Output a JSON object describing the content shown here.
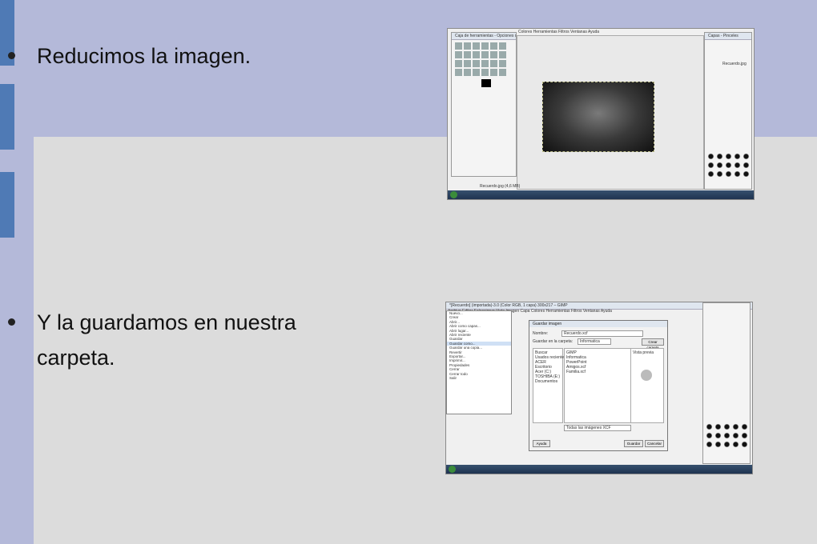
{
  "slide": {
    "bullets": [
      "Reducimos la imagen.",
      "Y la guardamos en nuestra carpeta."
    ]
  },
  "shot1": {
    "title": "Caja de herramientas - Opciones de herram...",
    "menu": "Colores  Herramientas  Filtros  Ventanas  Ayuda",
    "right_title": "Capas - Pinceles",
    "layer_name": "Recuerdo.jpg",
    "status": "Recuerdo.jpg (4,6 MB)"
  },
  "shot2": {
    "title": "*[Recuerdo] (importada)-3.0 (Color RGB, 1 capa) 300x217 – GIMP",
    "menubar": "Archivo  Editar  Seleccionar  Vista  Imagen  Capa  Colores  Herramientas  Filtros  Ventanas  Ayuda",
    "menu_items": [
      "Nuevo...",
      "Crear",
      "Abrir...",
      "Abrir como capas...",
      "Abrir lugar...",
      "Abrir reciente",
      "Guardar",
      "Guardar como...",
      "Guardar una copia...",
      "Revertir",
      "Exportar...",
      "Imprimir...",
      "Propiedades",
      "Cerrar",
      "Cerrar todo",
      "Salir"
    ],
    "dialog_title": "Guardar imagen",
    "name_label": "Nombre:",
    "name_value": "Recuerdo.xcf",
    "folder_label": "Guardar en la carpeta:",
    "folder_value": "Informatica",
    "create_folder": "Crear carpeta",
    "places": [
      "Buscar",
      "Usados recientemente",
      "ACER",
      "Escritorio",
      "Acer (C:)",
      "TOSHIBA (E:)",
      "Documentos"
    ],
    "files": [
      "GIMP",
      "Informatica",
      "PowerPoint",
      "Amigos.xcf",
      "Familia.xcf"
    ],
    "preview": "Vista previa",
    "help": "Ayuda",
    "save": "Guardar",
    "cancel": "Cancelar",
    "filter": "Todas las imágenes XCF"
  }
}
